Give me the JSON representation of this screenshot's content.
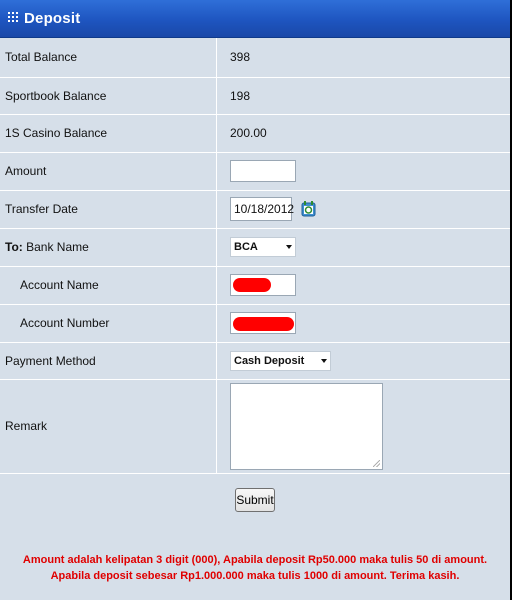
{
  "title": "Deposit",
  "rows": {
    "total_balance": {
      "label": "Total Balance",
      "value": "398"
    },
    "sportbook_balance": {
      "label": "Sportbook Balance",
      "value": "198"
    },
    "casino_balance": {
      "label": "1S Casino Balance",
      "value": "200.00"
    },
    "amount": {
      "label": "Amount",
      "value": ""
    },
    "transfer_date": {
      "label": "Transfer Date",
      "value": "10/18/2012"
    },
    "bank_name": {
      "label_prefix": "To:",
      "label": " Bank Name",
      "selected": "BCA"
    },
    "account_name": {
      "label": "Account Name"
    },
    "account_number": {
      "label": "Account Number"
    },
    "payment_method": {
      "label": "Payment Method",
      "selected": "Cash Deposit"
    },
    "remark": {
      "label": "Remark",
      "value": ""
    }
  },
  "submit_label": "Submit",
  "notice": "Amount adalah kelipatan 3 digit (000), Apabila deposit Rp50.000 maka tulis 50 di amount. Apabila deposit sebesar Rp1.000.000 maka tulis 1000 di amount. Terima kasih.",
  "colors": {
    "header": "#1e55c0",
    "panel": "#d6dfe9",
    "notice": "#e00000",
    "redaction": "#ff0000"
  },
  "icons": {
    "header_grip": "grip-dots-icon",
    "calendar": "calendar-icon",
    "dropdown": "chevron-down-icon"
  }
}
